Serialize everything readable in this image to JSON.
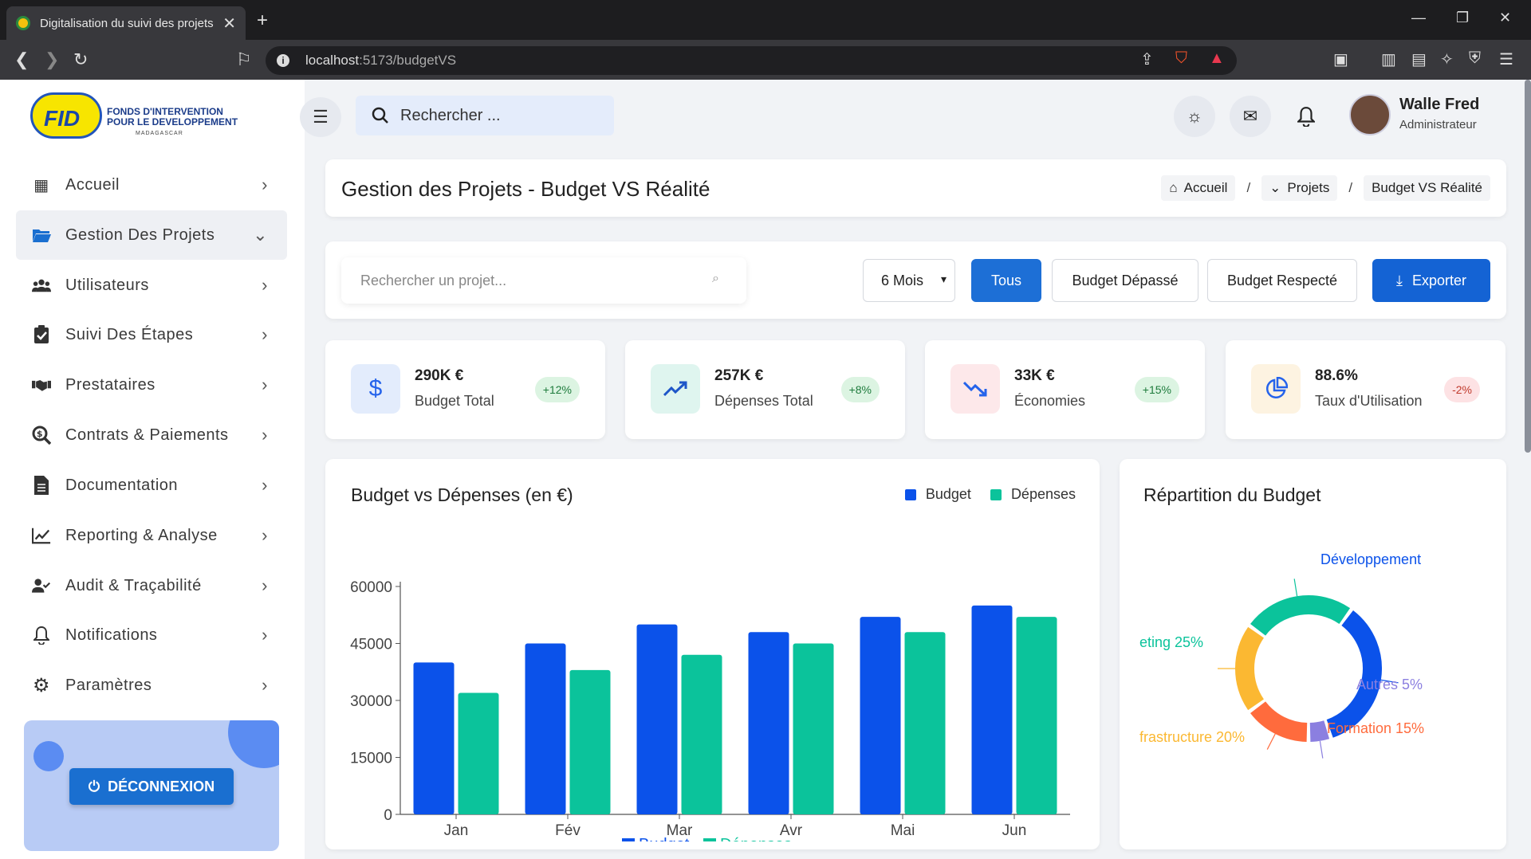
{
  "browser": {
    "tab_title": "Digitalisation du suivi des projets",
    "url_host": "localhost",
    "url_rest": ":5173/budgetVS"
  },
  "logo": {
    "mark": "FID",
    "line1": "FONDS D'INTERVENTION",
    "line2": "POUR LE DEVELOPPEMENT",
    "line3": "MADAGASCAR"
  },
  "sidebar": {
    "items": [
      {
        "label": "Accueil",
        "icon": "grid-icon"
      },
      {
        "label": "Gestion Des Projets",
        "icon": "folder-icon"
      },
      {
        "label": "Utilisateurs",
        "icon": "users-icon"
      },
      {
        "label": "Suivi Des Étapes",
        "icon": "clipboard-check-icon"
      },
      {
        "label": "Prestataires",
        "icon": "handshake-icon"
      },
      {
        "label": "Contrats & Paiements",
        "icon": "search-dollar-icon"
      },
      {
        "label": "Documentation",
        "icon": "document-icon"
      },
      {
        "label": "Reporting & Analyse",
        "icon": "chart-line-icon"
      },
      {
        "label": "Audit & Traçabilité",
        "icon": "user-check-icon"
      },
      {
        "label": "Notifications",
        "icon": "bell-icon"
      },
      {
        "label": "Paramètres",
        "icon": "gear-icon"
      }
    ],
    "logout_label": "DÉCONNEXION"
  },
  "topbar": {
    "search_placeholder": "Rechercher ...",
    "user_name": "Walle Fred",
    "user_role": "Administrateur"
  },
  "page": {
    "title": "Gestion des Projets - Budget VS Réalité",
    "breadcrumb": [
      "Accueil",
      "Projets",
      "Budget VS Réalité"
    ]
  },
  "filters": {
    "search_placeholder": "Rechercher un projet...",
    "period": "6 Mois",
    "btn_tous": "Tous",
    "btn_depasse": "Budget Dépassé",
    "btn_respecte": "Budget Respecté",
    "btn_export": "Exporter"
  },
  "stats": [
    {
      "value": "290K €",
      "label": "Budget Total",
      "badge": "+12%",
      "icon": "dollar-icon",
      "color": "#2563eb",
      "bg": "#e3ecfc",
      "badge_color": "#1e7b3c",
      "badge_bg": "#dcf4e2"
    },
    {
      "value": "257K €",
      "label": "Dépenses Total",
      "badge": "+8%",
      "icon": "trend-up-icon",
      "color": "#1e56c8",
      "bg": "#dff5ef",
      "badge_color": "#1e7b3c",
      "badge_bg": "#dcf4e2"
    },
    {
      "value": "33K €",
      "label": "Économies",
      "badge": "+15%",
      "icon": "trend-down-icon",
      "color": "#2563eb",
      "bg": "#fde8ea",
      "badge_color": "#1e7b3c",
      "badge_bg": "#dcf4e2"
    },
    {
      "value": "88.6%",
      "label": "Taux d'Utilisation",
      "badge": "-2%",
      "icon": "pie-chart-icon",
      "color": "#2563eb",
      "bg": "#fdf3e1",
      "badge_color": "#c0392b",
      "badge_bg": "#fde2e4"
    }
  ],
  "bar_chart_title": "Budget vs Dépenses (en €)",
  "donut_title": "Répartition du Budget",
  "chart_data": [
    {
      "type": "bar",
      "title": "Budget vs Dépenses (en €)",
      "categories": [
        "Jan",
        "Fév",
        "Mar",
        "Avr",
        "Mai",
        "Jun"
      ],
      "series": [
        {
          "name": "Budget",
          "color": "#0b52ea",
          "values": [
            40000,
            45000,
            50000,
            48000,
            52000,
            55000
          ]
        },
        {
          "name": "Dépenses",
          "color": "#0bc39b",
          "values": [
            32000,
            38000,
            42000,
            45000,
            48000,
            52000
          ]
        }
      ],
      "ylim": [
        0,
        60000
      ],
      "yticks": [
        "0",
        "15000",
        "30000",
        "45000",
        "60000"
      ],
      "legend": "top-right and bottom",
      "grid": false
    },
    {
      "type": "pie",
      "title": "Répartition du Budget",
      "slices": [
        {
          "label": "Développement",
          "value": 35,
          "color": "#0b52ea",
          "text": "Développement"
        },
        {
          "label": "Autres",
          "value": 5,
          "color": "#8b7fe0",
          "text": "Autres 5%"
        },
        {
          "label": "Formation",
          "value": 15,
          "color": "#ff6b3d",
          "text": "Formation 15%"
        },
        {
          "label": "Infrastructure",
          "value": 20,
          "color": "#fbb832",
          "text": "frastructure 20%"
        },
        {
          "label": "Marketing",
          "value": 25,
          "color": "#0bc39b",
          "text": "eting 25%"
        }
      ]
    }
  ]
}
